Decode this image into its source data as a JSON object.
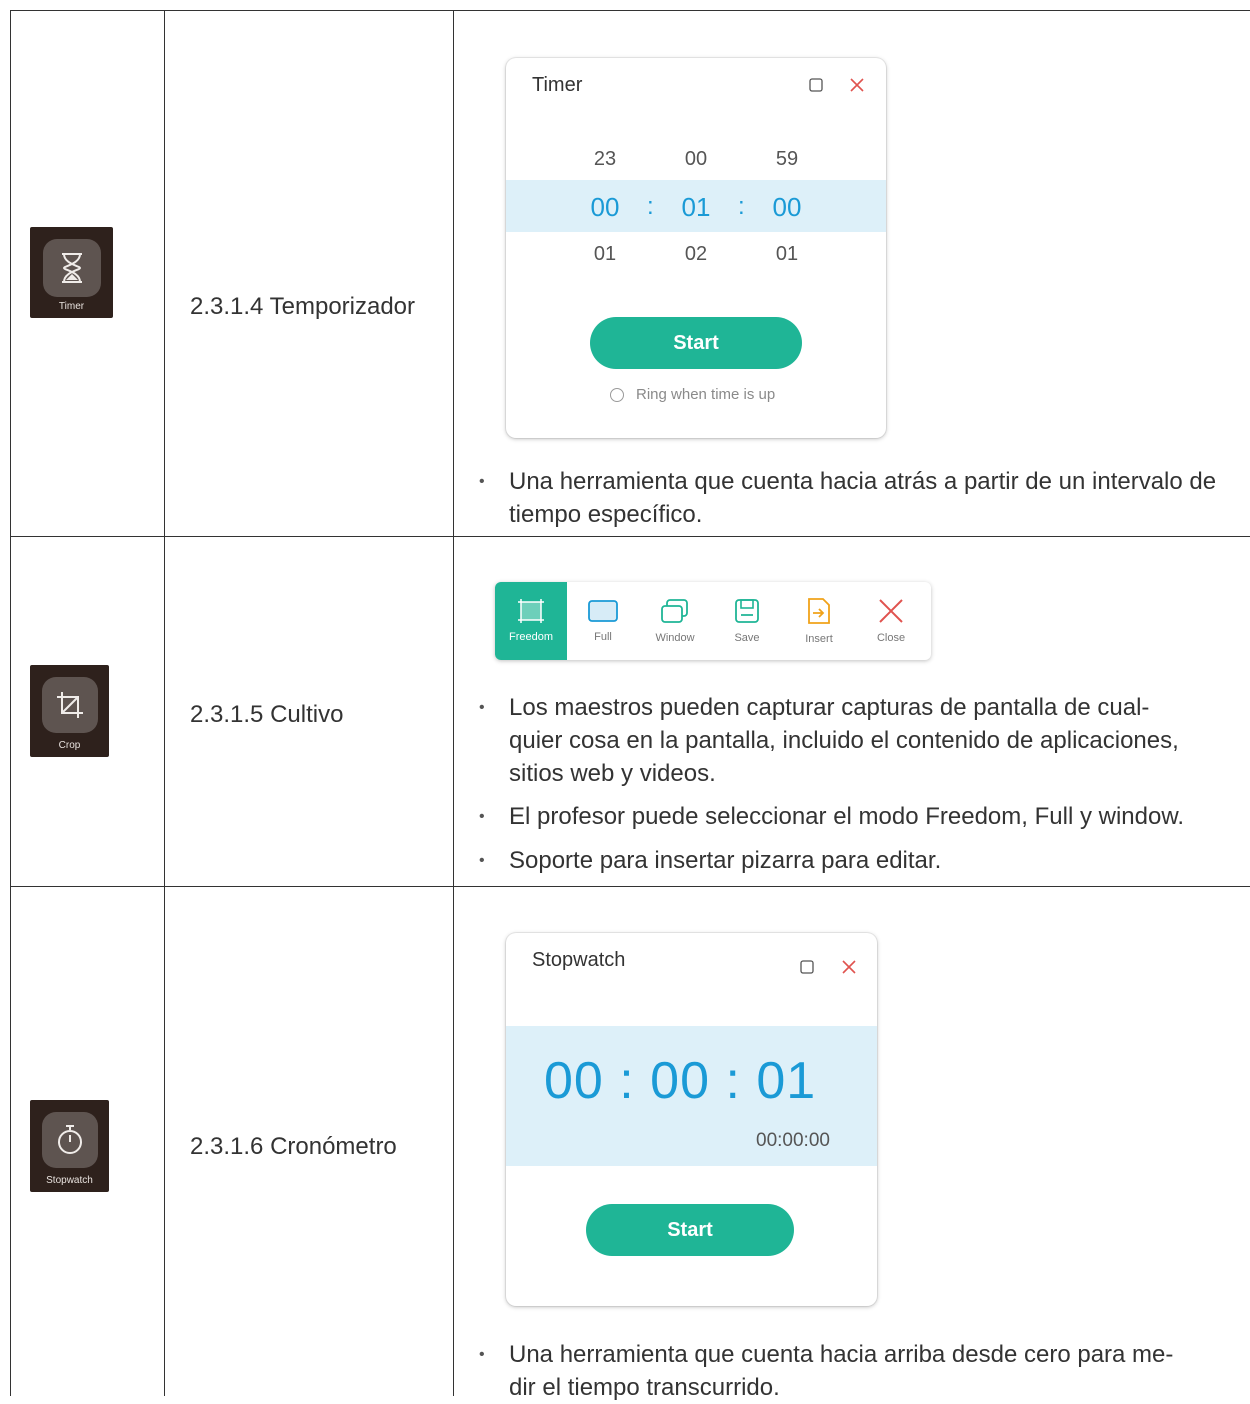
{
  "rows": [
    {
      "icon_name": "hourglass-icon",
      "icon_caption": "Timer",
      "title": "2.3.1.4 Temporizador",
      "window": {
        "title": "Timer",
        "picker_prev": [
          "23",
          "00",
          "59"
        ],
        "picker_selected": [
          "00",
          "01",
          "00"
        ],
        "picker_next": [
          "01",
          "02",
          "01"
        ],
        "separator": ":",
        "start_label": "Start",
        "ring_label": "Ring when time is up"
      },
      "bullets": [
        "Una herramienta que cuenta hacia atrás a partir de un intervalo de tiempo específico."
      ]
    },
    {
      "icon_name": "crop-icon",
      "icon_caption": "Crop",
      "title": "2.3.1.5 Cultivo",
      "toolbar": [
        {
          "label": "Freedom",
          "icon": "freedom-select-icon",
          "active": true
        },
        {
          "label": "Full",
          "icon": "full-screen-icon",
          "active": false
        },
        {
          "label": "Window",
          "icon": "window-icon",
          "active": false
        },
        {
          "label": "Save",
          "icon": "save-icon",
          "active": false
        },
        {
          "label": "Insert",
          "icon": "insert-icon",
          "active": false
        },
        {
          "label": "Close",
          "icon": "close-icon",
          "active": false
        }
      ],
      "bullets": [
        "Los maestros pueden capturar capturas de pantalla de cual-",
        "quier cosa en la pantalla, incluido el contenido de aplicaciones,",
        "sitios web y videos.",
        "El profesor puede seleccionar el modo Freedom, Full y window.",
        "Soporte para insertar pizarra para editar."
      ]
    },
    {
      "icon_name": "stopwatch-icon",
      "icon_caption": "Stopwatch",
      "title": "2.3.1.6 Cronómetro",
      "window": {
        "title": "Stopwatch",
        "time": "00 : 00 : 01",
        "lap": "00:00:00",
        "start_label": "Start"
      },
      "bullets": [
        "Una herramienta que cuenta hacia arriba desde cero para me-",
        "dir el tiempo transcurrido."
      ]
    }
  ],
  "colors": {
    "accent_green": "#1fb596",
    "accent_blue": "#1a9ad6",
    "selection_band": "#ddf0f9",
    "close_red": "#e0534f",
    "icon_background": "#2e211c"
  }
}
